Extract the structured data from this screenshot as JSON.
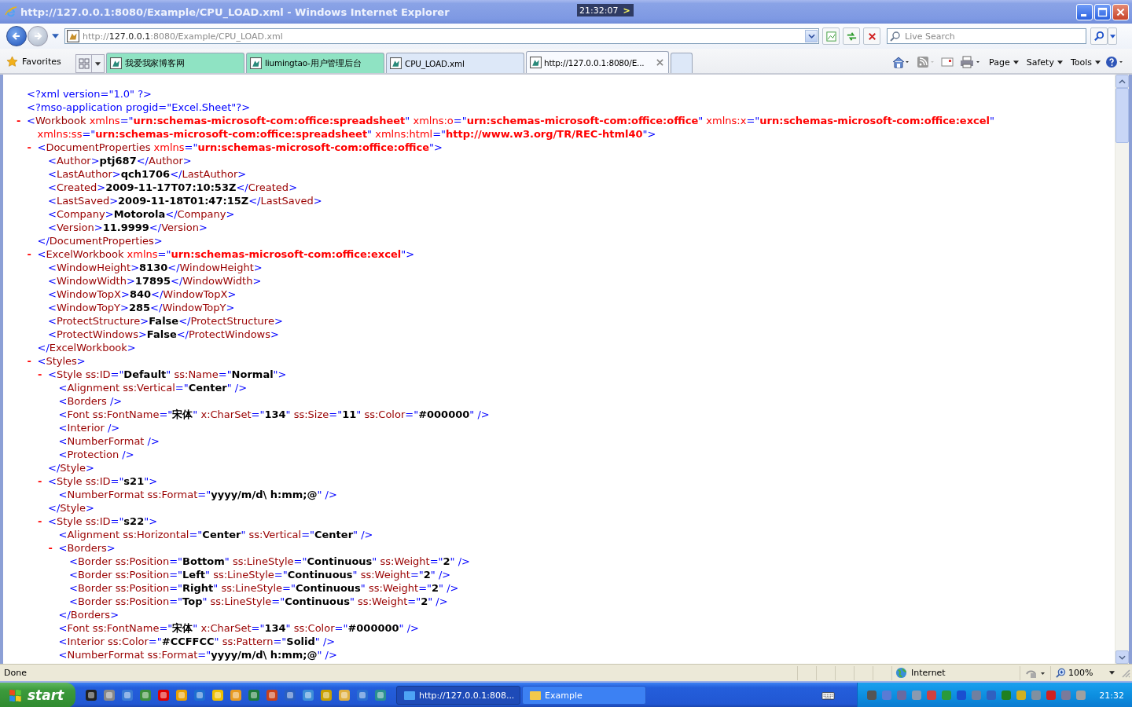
{
  "window": {
    "title": "http://127.0.0.1:8080/Example/CPU_LOAD.xml - Windows Internet Explorer",
    "clock": "21:32:07",
    "clock_arrow": ">"
  },
  "address_bar": {
    "scheme": "http://",
    "host": "127.0.0.1",
    "rest": ":8080/Example/CPU_LOAD.xml"
  },
  "search": {
    "placeholder": "Live Search"
  },
  "favorites": {
    "label": "Favorites"
  },
  "tabs": [
    {
      "label": "我爱我家博客网",
      "color": "#8fe3c3",
      "selected": false
    },
    {
      "label": "liumingtao-用户管理后台",
      "color": "#8fe3c3",
      "selected": false
    },
    {
      "label": "CPU_LOAD.xml",
      "color": "#dde8f8",
      "selected": false
    },
    {
      "label": "http://127.0.0.1:8080/E...",
      "color": "#f8fafe",
      "selected": true
    }
  ],
  "command_bar": [
    {
      "label": "Page"
    },
    {
      "label": "Safety"
    },
    {
      "label": "Tools"
    }
  ],
  "document": {
    "nodes": [
      {
        "kind": "pi",
        "text": "<?xml version=\"1.0\" ?>"
      },
      {
        "kind": "pi",
        "text": "<?mso-application progid=\"Excel.Sheet\"?>"
      },
      {
        "kind": "ns",
        "toggle": "-",
        "text": "<Workbook xmlns=\"urn:schemas-microsoft-com:office:spreadsheet\" xmlns:o=\"urn:schemas-microsoft-com:office:office\" xmlns:x=\"urn:schemas-microsoft-com:office:excel\"",
        "text_2": "xmlns:ss=\"urn:schemas-microsoft-com:office:spreadsheet\" xmlns:html=\"http://www.w3.org/TR/REC-html40\">",
        "children": [
          {
            "kind": "ns",
            "toggle": "-",
            "text": "<DocumentProperties xmlns=\"urn:schemas-microsoft-com:office:office\">",
            "end": "</DocumentProperties>",
            "children": [
              {
                "kind": "element",
                "text": "<Author>ptj687</Author>"
              },
              {
                "kind": "element",
                "text": "<LastAuthor>qch1706</LastAuthor>"
              },
              {
                "kind": "element",
                "text": "<Created>2009-11-17T07:10:53Z</Created>"
              },
              {
                "kind": "element",
                "text": "<LastSaved>2009-11-18T01:47:15Z</LastSaved>"
              },
              {
                "kind": "element",
                "text": "<Company>Motorola</Company>"
              },
              {
                "kind": "element",
                "text": "<Version>11.9999</Version>"
              }
            ]
          },
          {
            "kind": "ns",
            "toggle": "-",
            "text": "<ExcelWorkbook xmlns=\"urn:schemas-microsoft-com:office:excel\">",
            "end": "</ExcelWorkbook>",
            "children": [
              {
                "kind": "element",
                "text": "<WindowHeight>8130</WindowHeight>"
              },
              {
                "kind": "element",
                "text": "<WindowWidth>17895</WindowWidth>"
              },
              {
                "kind": "element",
                "text": "<WindowTopX>840</WindowTopX>"
              },
              {
                "kind": "element",
                "text": "<WindowTopY>285</WindowTopY>"
              },
              {
                "kind": "element",
                "text": "<ProtectStructure>False</ProtectStructure>"
              },
              {
                "kind": "element",
                "text": "<ProtectWindows>False</ProtectWindows>"
              }
            ]
          },
          {
            "kind": "element",
            "toggle": "-",
            "text": "<Styles>",
            "children": [
              {
                "kind": "element",
                "toggle": "-",
                "text": "<Style ss:ID=\"Default\" ss:Name=\"Normal\">",
                "end": "</Style>",
                "children": [
                  {
                    "kind": "element",
                    "text": "<Alignment ss:Vertical=\"Center\" />"
                  },
                  {
                    "kind": "element",
                    "text": "<Borders />"
                  },
                  {
                    "kind": "element",
                    "text": "<Font ss:FontName=\"宋体\" x:CharSet=\"134\" ss:Size=\"11\" ss:Color=\"#000000\" />"
                  },
                  {
                    "kind": "element",
                    "text": "<Interior />"
                  },
                  {
                    "kind": "element",
                    "text": "<NumberFormat />"
                  },
                  {
                    "kind": "element",
                    "text": "<Protection />"
                  }
                ]
              },
              {
                "kind": "element",
                "toggle": "-",
                "text": "<Style ss:ID=\"s21\">",
                "end": "</Style>",
                "children": [
                  {
                    "kind": "element",
                    "text": "<NumberFormat ss:Format=\"yyyy/m/d\\ h:mm;@\" />"
                  }
                ]
              },
              {
                "kind": "element",
                "toggle": "-",
                "text": "<Style ss:ID=\"s22\">",
                "children": [
                  {
                    "kind": "element",
                    "text": "<Alignment ss:Horizontal=\"Center\" ss:Vertical=\"Center\" />"
                  },
                  {
                    "kind": "element",
                    "toggle": "-",
                    "text": "<Borders>",
                    "end": "</Borders>",
                    "children": [
                      {
                        "kind": "element",
                        "text": "<Border ss:Position=\"Bottom\" ss:LineStyle=\"Continuous\" ss:Weight=\"2\" />"
                      },
                      {
                        "kind": "element",
                        "text": "<Border ss:Position=\"Left\" ss:LineStyle=\"Continuous\" ss:Weight=\"2\" />"
                      },
                      {
                        "kind": "element",
                        "text": "<Border ss:Position=\"Right\" ss:LineStyle=\"Continuous\" ss:Weight=\"2\" />"
                      },
                      {
                        "kind": "element",
                        "text": "<Border ss:Position=\"Top\" ss:LineStyle=\"Continuous\" ss:Weight=\"2\" />"
                      }
                    ]
                  },
                  {
                    "kind": "element",
                    "text": "<Font ss:FontName=\"宋体\" x:CharSet=\"134\" ss:Color=\"#000000\" />"
                  },
                  {
                    "kind": "element",
                    "text": "<Interior ss:Color=\"#CCFFCC\" ss:Pattern=\"Solid\" />"
                  },
                  {
                    "kind": "element",
                    "text": "<NumberFormat ss:Format=\"yyyy/m/d\\ h:mm;@\" />"
                  }
                ]
              }
            ]
          }
        ]
      }
    ]
  },
  "status_bar": {
    "text": "Done",
    "zone": "Internet",
    "zoom": "100%"
  },
  "taskbar": {
    "start": "start",
    "tasks": [
      {
        "label": "http://127.0.0.1:808...",
        "selected": true
      },
      {
        "label": "Example",
        "selected": false
      }
    ],
    "clock": "21:32"
  }
}
